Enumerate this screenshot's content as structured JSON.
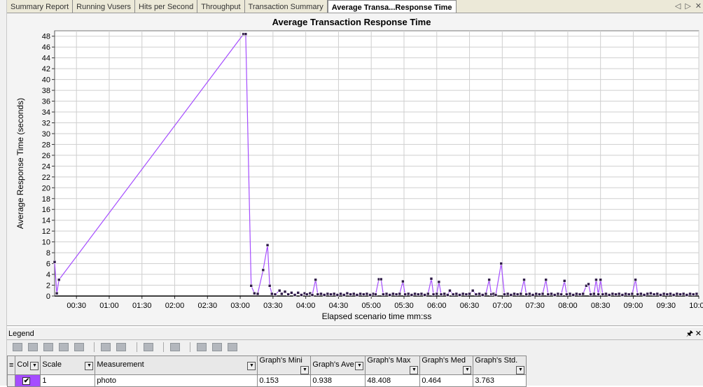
{
  "tabs": [
    {
      "label": "Summary Report",
      "active": false
    },
    {
      "label": "Running Vusers",
      "active": false
    },
    {
      "label": "Hits per Second",
      "active": false
    },
    {
      "label": "Throughput",
      "active": false
    },
    {
      "label": "Transaction Summary",
      "active": false
    },
    {
      "label": "Average Transa...Response Time",
      "active": true
    }
  ],
  "tab_nav": {
    "prev": "◁",
    "next": "▷",
    "close": "✕"
  },
  "chart_data": {
    "type": "line",
    "title": "Average Transaction Response Time",
    "xlabel": "Elapsed scenario time mm:ss",
    "ylabel": "Average Response Time (seconds)",
    "xlim": [
      10,
      600
    ],
    "ylim": [
      0,
      49
    ],
    "yticks": [
      0,
      2,
      4,
      6,
      8,
      10,
      12,
      14,
      16,
      18,
      20,
      22,
      24,
      26,
      28,
      30,
      32,
      34,
      36,
      38,
      40,
      42,
      44,
      46,
      48
    ],
    "xticks": [
      {
        "v": 30,
        "label": "00:30"
      },
      {
        "v": 60,
        "label": "01:00"
      },
      {
        "v": 90,
        "label": "01:30"
      },
      {
        "v": 120,
        "label": "02:00"
      },
      {
        "v": 150,
        "label": "02:30"
      },
      {
        "v": 180,
        "label": "03:00"
      },
      {
        "v": 210,
        "label": "03:30"
      },
      {
        "v": 240,
        "label": "04:00"
      },
      {
        "v": 270,
        "label": "04:30"
      },
      {
        "v": 300,
        "label": "05:00"
      },
      {
        "v": 330,
        "label": "05:30"
      },
      {
        "v": 360,
        "label": "06:00"
      },
      {
        "v": 390,
        "label": "06:30"
      },
      {
        "v": 420,
        "label": "07:00"
      },
      {
        "v": 450,
        "label": "07:30"
      },
      {
        "v": 480,
        "label": "08:00"
      },
      {
        "v": 510,
        "label": "08:30"
      },
      {
        "v": 540,
        "label": "09:00"
      },
      {
        "v": 570,
        "label": "09:30"
      },
      {
        "v": 600,
        "label": "10:00"
      }
    ],
    "grid": true,
    "series": [
      {
        "name": "photo",
        "color": "#a54dff",
        "marker_color": "#2e1a47",
        "points": [
          [
            10,
            6.3
          ],
          [
            12,
            0.5
          ],
          [
            14,
            3.0
          ],
          [
            183,
            48.4
          ],
          [
            185,
            48.4
          ],
          [
            190,
            1.9
          ],
          [
            193,
            0.5
          ],
          [
            196,
            0.4
          ],
          [
            201,
            4.8
          ],
          [
            205,
            9.4
          ],
          [
            207,
            1.9
          ],
          [
            209,
            0.4
          ],
          [
            212,
            0.3
          ],
          [
            216,
            1.0
          ],
          [
            218,
            0.4
          ],
          [
            221,
            0.8
          ],
          [
            224,
            0.3
          ],
          [
            227,
            0.6
          ],
          [
            230,
            0.2
          ],
          [
            233,
            0.6
          ],
          [
            236,
            0.2
          ],
          [
            239,
            0.5
          ],
          [
            241,
            0.3
          ],
          [
            244,
            0.5
          ],
          [
            246,
            0.2
          ],
          [
            249,
            3.0
          ],
          [
            251,
            0.3
          ],
          [
            254,
            0.4
          ],
          [
            257,
            0.2
          ],
          [
            260,
            0.4
          ],
          [
            263,
            0.3
          ],
          [
            266,
            0.4
          ],
          [
            269,
            0.2
          ],
          [
            272,
            0.4
          ],
          [
            275,
            0.2
          ],
          [
            278,
            0.5
          ],
          [
            281,
            0.3
          ],
          [
            284,
            0.4
          ],
          [
            287,
            0.2
          ],
          [
            290,
            0.4
          ],
          [
            293,
            0.3
          ],
          [
            296,
            0.4
          ],
          [
            299,
            0.2
          ],
          [
            302,
            0.4
          ],
          [
            304,
            0.3
          ],
          [
            307,
            3.1
          ],
          [
            309,
            3.1
          ],
          [
            311,
            0.3
          ],
          [
            314,
            0.4
          ],
          [
            317,
            0.2
          ],
          [
            320,
            0.4
          ],
          [
            323,
            0.3
          ],
          [
            326,
            0.4
          ],
          [
            329,
            2.7
          ],
          [
            331,
            0.3
          ],
          [
            334,
            0.4
          ],
          [
            337,
            0.2
          ],
          [
            340,
            0.4
          ],
          [
            343,
            0.3
          ],
          [
            346,
            0.4
          ],
          [
            349,
            0.2
          ],
          [
            352,
            0.4
          ],
          [
            355,
            3.2
          ],
          [
            357,
            0.3
          ],
          [
            360,
            0.4
          ],
          [
            362,
            2.6
          ],
          [
            364,
            0.3
          ],
          [
            367,
            0.4
          ],
          [
            370,
            0.2
          ],
          [
            372,
            1.0
          ],
          [
            375,
            0.3
          ],
          [
            378,
            0.4
          ],
          [
            381,
            0.2
          ],
          [
            384,
            0.4
          ],
          [
            387,
            0.3
          ],
          [
            390,
            0.4
          ],
          [
            393,
            1.0
          ],
          [
            396,
            0.3
          ],
          [
            399,
            0.4
          ],
          [
            402,
            0.2
          ],
          [
            405,
            0.4
          ],
          [
            408,
            3.0
          ],
          [
            410,
            0.3
          ],
          [
            412,
            0.4
          ],
          [
            414,
            0.2
          ],
          [
            419,
            6.0
          ],
          [
            422,
            0.3
          ],
          [
            425,
            0.4
          ],
          [
            428,
            0.2
          ],
          [
            431,
            0.4
          ],
          [
            434,
            0.3
          ],
          [
            437,
            0.4
          ],
          [
            440,
            3.0
          ],
          [
            442,
            0.3
          ],
          [
            445,
            0.4
          ],
          [
            448,
            0.2
          ],
          [
            451,
            0.4
          ],
          [
            454,
            0.3
          ],
          [
            457,
            0.4
          ],
          [
            460,
            3.0
          ],
          [
            462,
            0.3
          ],
          [
            465,
            0.4
          ],
          [
            468,
            0.2
          ],
          [
            471,
            0.4
          ],
          [
            474,
            0.3
          ],
          [
            477,
            2.8
          ],
          [
            479,
            0.3
          ],
          [
            482,
            0.4
          ],
          [
            485,
            0.2
          ],
          [
            488,
            0.4
          ],
          [
            491,
            0.3
          ],
          [
            494,
            0.4
          ],
          [
            497,
            1.9
          ],
          [
            499,
            2.2
          ],
          [
            501,
            0.3
          ],
          [
            504,
            0.4
          ],
          [
            506,
            3.0
          ],
          [
            508,
            0.3
          ],
          [
            510,
            3.0
          ],
          [
            512,
            0.3
          ],
          [
            515,
            0.4
          ],
          [
            518,
            0.2
          ],
          [
            521,
            0.4
          ],
          [
            524,
            0.3
          ],
          [
            527,
            0.4
          ],
          [
            530,
            0.2
          ],
          [
            533,
            0.4
          ],
          [
            536,
            0.3
          ],
          [
            539,
            0.4
          ],
          [
            542,
            3.0
          ],
          [
            544,
            0.3
          ],
          [
            547,
            0.4
          ],
          [
            550,
            0.2
          ],
          [
            553,
            0.4
          ],
          [
            556,
            0.5
          ],
          [
            559,
            0.3
          ],
          [
            562,
            0.4
          ],
          [
            565,
            0.2
          ],
          [
            568,
            0.4
          ],
          [
            571,
            0.3
          ],
          [
            574,
            0.4
          ],
          [
            577,
            0.2
          ],
          [
            580,
            0.4
          ],
          [
            583,
            0.3
          ],
          [
            586,
            0.4
          ],
          [
            589,
            0.2
          ],
          [
            592,
            0.4
          ],
          [
            595,
            0.3
          ],
          [
            598,
            0.4
          ]
        ]
      }
    ]
  },
  "legend": {
    "title": "Legend",
    "pin_icon": "pin-icon",
    "close_icon": "close-icon",
    "columns": [
      "Col",
      "Scale",
      "Measurement",
      "Graph's Mini",
      "Graph's Ave",
      "Graph's Max",
      "Graph's Med",
      "Graph's Std."
    ],
    "rows": [
      {
        "color": "#a54dff",
        "checked": true,
        "scale": "1",
        "measurement": "photo",
        "min": "0.153",
        "avg": "0.938",
        "max": "48.408",
        "median": "0.464",
        "std": "3.763"
      }
    ]
  }
}
